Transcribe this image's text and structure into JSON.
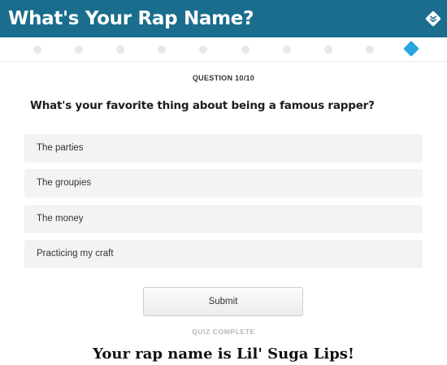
{
  "header": {
    "title": "What's Your Rap Name?",
    "collapse_icon": "double-chevron-down-icon",
    "background_color": "#1a6d8c"
  },
  "progress": {
    "current": 10,
    "total": 10,
    "active_color": "#2aa7e2"
  },
  "quiz": {
    "question_counter": "QUESTION 10/10",
    "question": "What's your favorite thing about being a famous rapper?",
    "options": [
      {
        "label": "The parties"
      },
      {
        "label": "The groupies"
      },
      {
        "label": "The money"
      },
      {
        "label": "Practicing my craft"
      }
    ],
    "submit_label": "Submit",
    "status": "QUIZ COMPLETE",
    "result": "Your rap name is Lil' Suga Lips!"
  }
}
